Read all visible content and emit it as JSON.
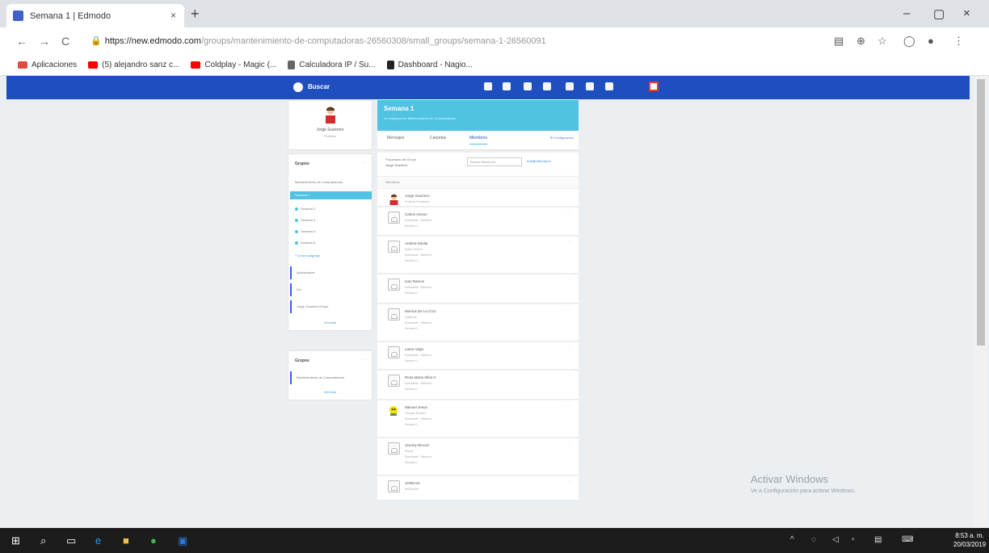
{
  "browser": {
    "tab_title": "Semana 1 | Edmodo",
    "tab_close": "×",
    "new_tab": "+",
    "window_controls": {
      "minimize": "–",
      "maximize": "▢",
      "close": "×"
    },
    "nav": {
      "back": "←",
      "forward": "→",
      "reload": "C"
    },
    "url_host": "https://new.edmodo.com",
    "url_path": "/groups/mantenimiento-de-computadoras-26560308/small_groups/semana-1-26560091",
    "bookmarks": [
      {
        "label": "Aplicaciones",
        "color": "#e04a3f"
      },
      {
        "label": "(5) alejandro sanz c...",
        "color": "#ff0000"
      },
      {
        "label": "Coldplay - Magic (...",
        "color": "#ff0000"
      },
      {
        "label": "Calculadora IP / Su...",
        "color": "#666666"
      },
      {
        "label": "Dashboard - Nagio...",
        "color": "#222222"
      }
    ]
  },
  "edmodo": {
    "accent": "#1f4fbf",
    "banner_color": "#4fc3e1",
    "search_label": "Buscar",
    "profile": {
      "name": "Jorge Guerrero",
      "role": "Profesor"
    },
    "groups_title": "Grupos",
    "groups": [
      {
        "label": "Mantenimiento de Computadoras",
        "style": "plain"
      },
      {
        "label": "Semana 1",
        "style": "selected"
      },
      {
        "label": "Semana 2",
        "style": "sub"
      },
      {
        "label": "Semana 3",
        "style": "sub"
      },
      {
        "label": "Semana 4",
        "style": "sub"
      },
      {
        "label": "Semana 5",
        "style": "sub"
      },
      {
        "label": "+ Crear subgrupo",
        "style": "link"
      },
      {
        "label": "Aplicaciones",
        "style": "bar"
      },
      {
        "label": "Dci",
        "style": "bar"
      },
      {
        "label": "Jorge Guerrero Grupo",
        "style": "bar"
      }
    ],
    "see_all_1": "Ver todo",
    "groups2_title": "Grupos",
    "groups2": [
      {
        "label": "Mantenimiento de Computadoras"
      }
    ],
    "see_all_2": "Ver todo",
    "banner_title": "Semana 1",
    "banner_subtitle": "Un subgrupo de Mantenimiento de Computadoras",
    "tabs": [
      "Mensajes",
      "Carpetas",
      "Miembros"
    ],
    "settings_label": "⚙ Configuración",
    "filter_label": "Propietario del Grupo",
    "filter_value": "Jorge Guerrero",
    "search_placeholder": "Buscar Miembros",
    "invite_link": "Invitar Miembros",
    "list_header": "Miembros",
    "members": [
      {
        "name": "Jorge Guerrero",
        "details": [
          "Profesor Propietario"
        ],
        "avatar": "teacher"
      },
      {
        "name": "Carlos Alonso",
        "details": [
          "Estudiante · Miembro",
          "Semana 1"
        ],
        "avatar": "placeholder"
      },
      {
        "name": "Andrea Dávila",
        "details": [
          "Nuñez Puerta",
          "Estudiante · Miembro",
          "Semana 1"
        ],
        "avatar": "placeholder"
      },
      {
        "name": "Ivan Ramos",
        "details": [
          "Estudiante · Miembro",
          "Semana 1"
        ],
        "avatar": "placeholder"
      },
      {
        "name": "Monica De La Cruz",
        "details": [
          "Gutierrez",
          "Estudiante · Miembro",
          "Semana 1"
        ],
        "avatar": "placeholder"
      },
      {
        "name": "Laura Vega",
        "details": [
          "Estudiante · Miembro",
          "Semana 1"
        ],
        "avatar": "placeholder"
      },
      {
        "name": "Rosa Maria Silva H",
        "details": [
          "Estudiante · Miembro",
          "Semana 1"
        ],
        "avatar": "placeholder"
      },
      {
        "name": "Manuel Jesus",
        "details": [
          "Paredes Romero",
          "Estudiante · Miembro",
          "Semana 1"
        ],
        "avatar": "character"
      },
      {
        "name": "Jeremy Rincon",
        "details": [
          "Rivera",
          "Estudiante · Miembro",
          "Semana 1"
        ],
        "avatar": "placeholder"
      },
      {
        "name": "JORDAN",
        "details": [
          "ANDRADE"
        ],
        "avatar": "placeholder"
      }
    ]
  },
  "windows": {
    "watermark_title": "Activar Windows",
    "watermark_sub": "Ve a Configuración para activar Windows.",
    "time": "8:53 a. m.",
    "date": "20/03/2019"
  }
}
